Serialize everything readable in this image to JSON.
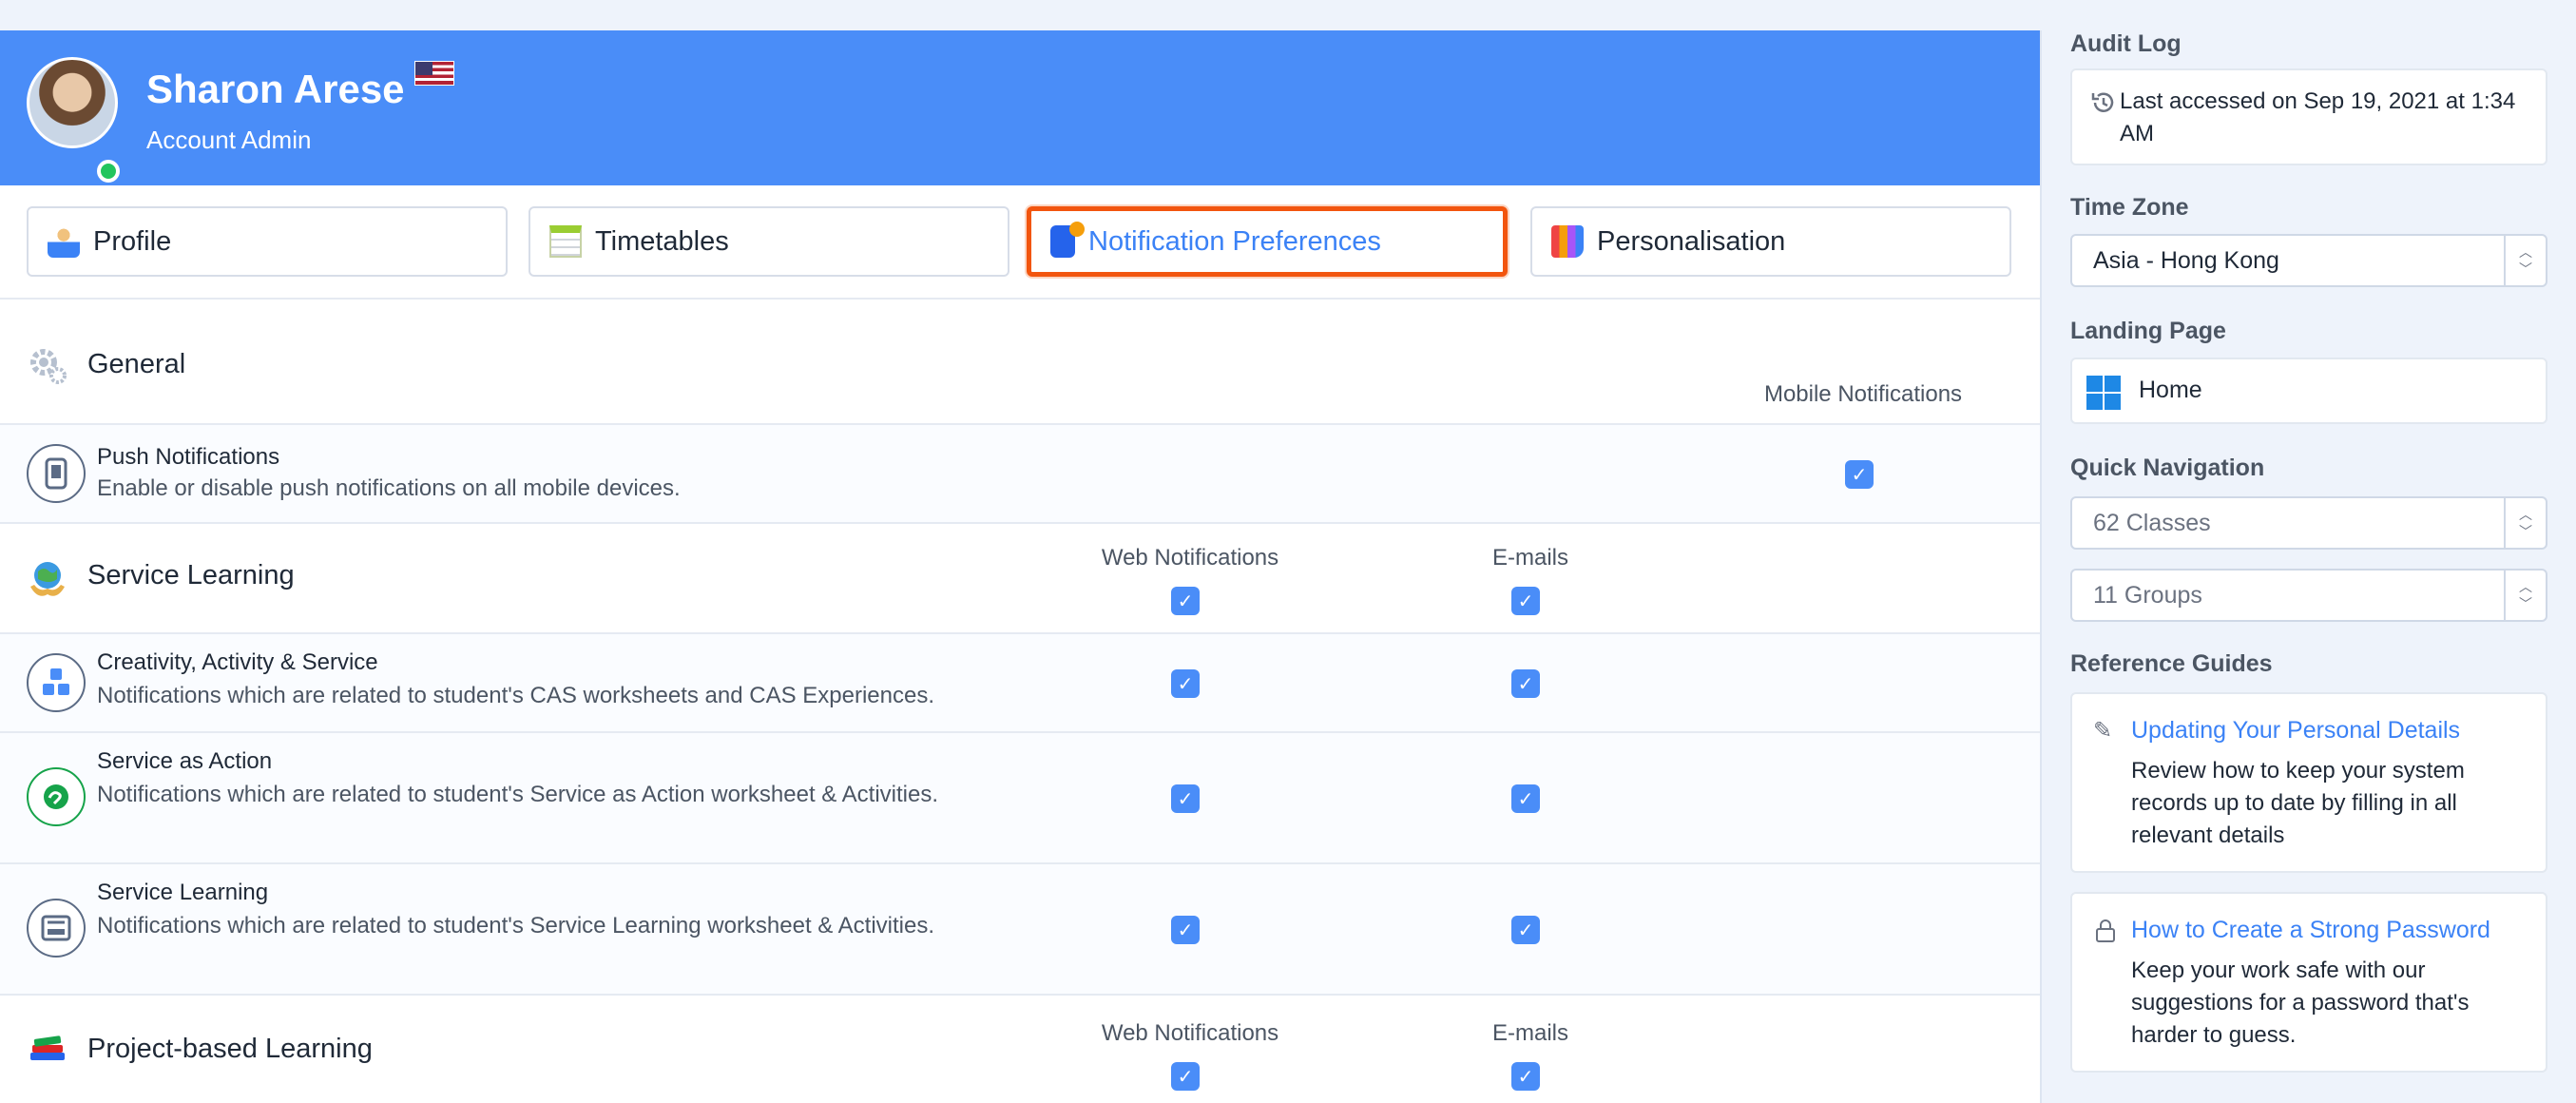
{
  "profile": {
    "name": "Sharon Arese",
    "role": "Account Admin"
  },
  "tabs": [
    {
      "label": "Profile",
      "icon": "profile-icon"
    },
    {
      "label": "Timetables",
      "icon": "timetable-icon"
    },
    {
      "label": "Notification Preferences",
      "icon": "phone-notification-icon",
      "active": true
    },
    {
      "label": "Personalisation",
      "icon": "palette-icon"
    }
  ],
  "general": {
    "title": "General",
    "column_mobile": "Mobile Notifications",
    "push": {
      "title": "Push Notifications",
      "desc": "Enable or disable push notifications on all mobile devices.",
      "mobile_checked": true
    }
  },
  "service_learning": {
    "title": "Service Learning",
    "column_web": "Web Notifications",
    "column_email": "E-mails",
    "rows": [
      {
        "title": "Creativity, Activity & Service",
        "desc": "Notifications which are related to student's CAS worksheets and CAS Experiences."
      },
      {
        "title": "Service as Action",
        "desc": "Notifications which are related to student's Service as Action worksheet & Activities."
      },
      {
        "title": "Service Learning",
        "desc": "Notifications which are related to student's Service Learning worksheet & Activities."
      }
    ]
  },
  "project_learning": {
    "title": "Project-based Learning",
    "column_web": "Web Notifications",
    "column_email": "E-mails"
  },
  "sidebar": {
    "audit_heading": "Audit Log",
    "audit_text": "Last accessed on Sep 19, 2021 at 1:34 AM",
    "timezone_heading": "Time Zone",
    "timezone_value": "Asia - Hong Kong",
    "landing_heading": "Landing Page",
    "landing_value": "Home",
    "quicknav_heading": "Quick Navigation",
    "quicknav_classes": "62 Classes",
    "quicknav_groups": "11 Groups",
    "guides_heading": "Reference Guides",
    "guides": [
      {
        "title": "Updating Your Personal Details",
        "text": "Review how to keep your system records up to date by filling in all relevant details"
      },
      {
        "title": "How to Create a Strong Password",
        "text": "Keep your work safe with our suggestions for a password that's harder to guess."
      }
    ]
  },
  "colors": {
    "header": "#4a8df8",
    "accent": "#3b82f6",
    "highlight": "#f2550e",
    "checkbox": "#4a8df8"
  }
}
